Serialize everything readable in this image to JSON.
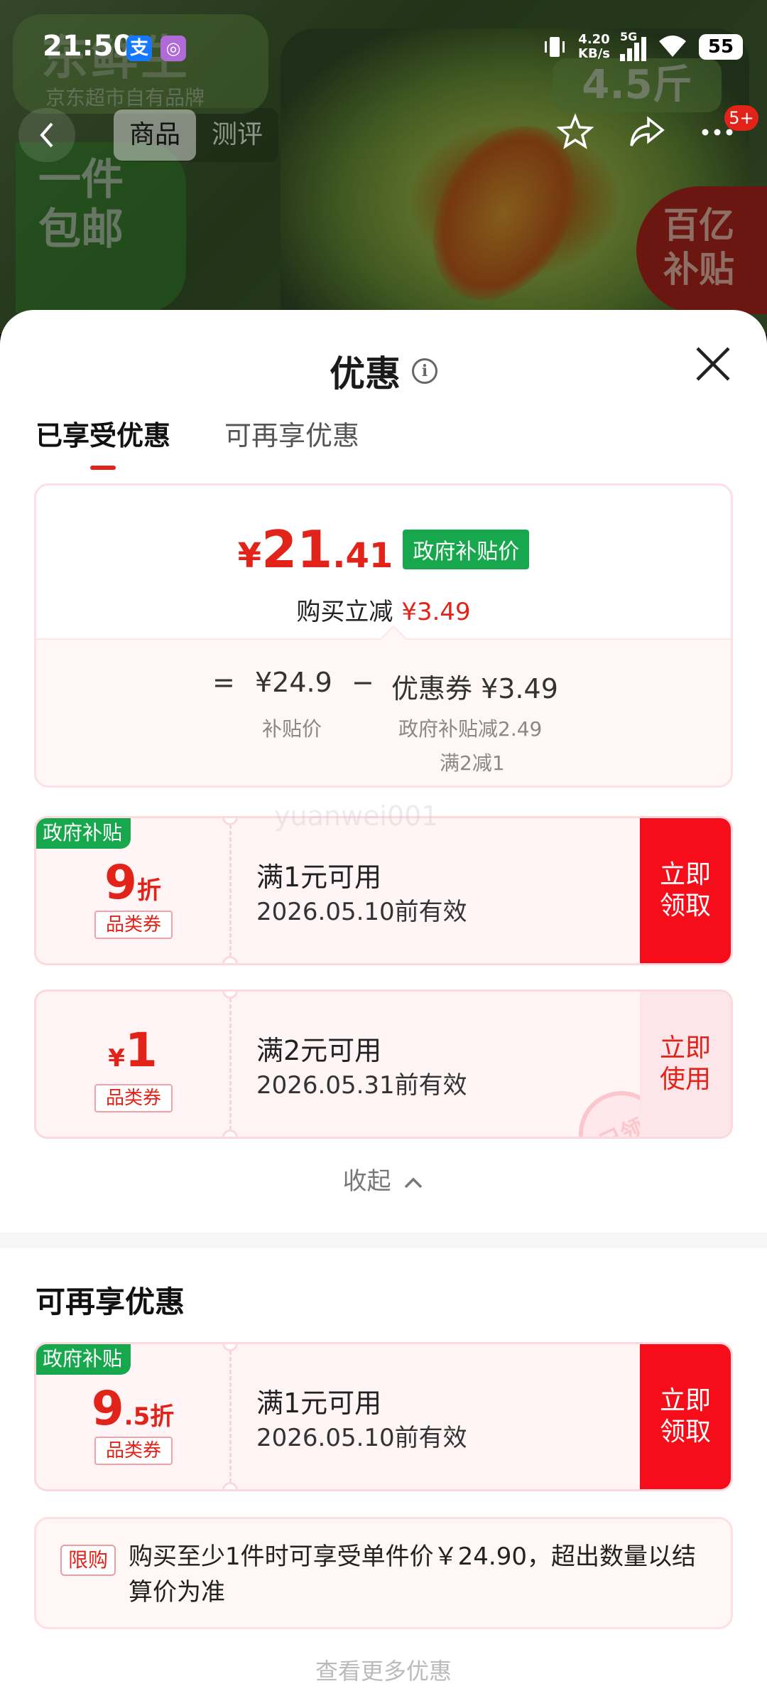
{
  "status_bar": {
    "time": "21:50",
    "app_a": "支",
    "app_b": "◎",
    "net_speed": "4.20",
    "net_unit": "KB/s",
    "network": "5G",
    "battery": "55"
  },
  "background": {
    "brand": "东鲜生",
    "brand_sub": "京东超市自有品牌",
    "shipping": "一件包邮",
    "weight": "4.5斤",
    "subsidy": "百亿补贴"
  },
  "nav": {
    "tabs": [
      {
        "label": "商品"
      },
      {
        "label": "测评"
      }
    ],
    "badge": "5+"
  },
  "sheet": {
    "title": "优惠",
    "tabs": [
      {
        "label": "已享受优惠"
      },
      {
        "label": "可再享优惠"
      }
    ],
    "summary": {
      "price_currency": "¥",
      "price_int": "21",
      "price_dec": ".41",
      "gov_tag": "政府补贴价",
      "instant_label": "购买立减",
      "instant_amount": "¥3.49",
      "eq": "=",
      "base_price": "¥24.9",
      "base_label": "补贴价",
      "minus": "−",
      "coupon_label": "优惠券 ¥3.49",
      "coupon_note1": "政府补贴减2.49",
      "coupon_note2": "满2减1"
    },
    "watermark": "yuanwei001",
    "coupons": [
      {
        "corner": "政府补贴",
        "discount_num": "9",
        "discount_suffix": "折",
        "category": "品类券",
        "condition": "满1元可用",
        "expiry": "2026.05.10前有效",
        "button": "立即领取"
      },
      {
        "corner": "",
        "discount_prefix": "¥",
        "discount_num": "1",
        "category": "品类券",
        "condition": "满2元可用",
        "expiry": "2026.05.31前有效",
        "button": "立即使用",
        "stamp": "已领"
      }
    ],
    "collapse": "收起",
    "more_section": {
      "title": "可再享优惠",
      "coupon": {
        "corner": "政府补贴",
        "discount_num": "9",
        "discount_suffix": ".5折",
        "category": "品类券",
        "condition": "满1元可用",
        "expiry": "2026.05.10前有效",
        "button": "立即领取"
      }
    },
    "limit": {
      "tag": "限购",
      "text": "购买至少1件时可享受单件价￥24.90，超出数量以结算价为准"
    },
    "more_hint": "查看更多优惠"
  },
  "colors": {
    "accent_red": "#e2231a",
    "gov_green": "#17a84d"
  }
}
